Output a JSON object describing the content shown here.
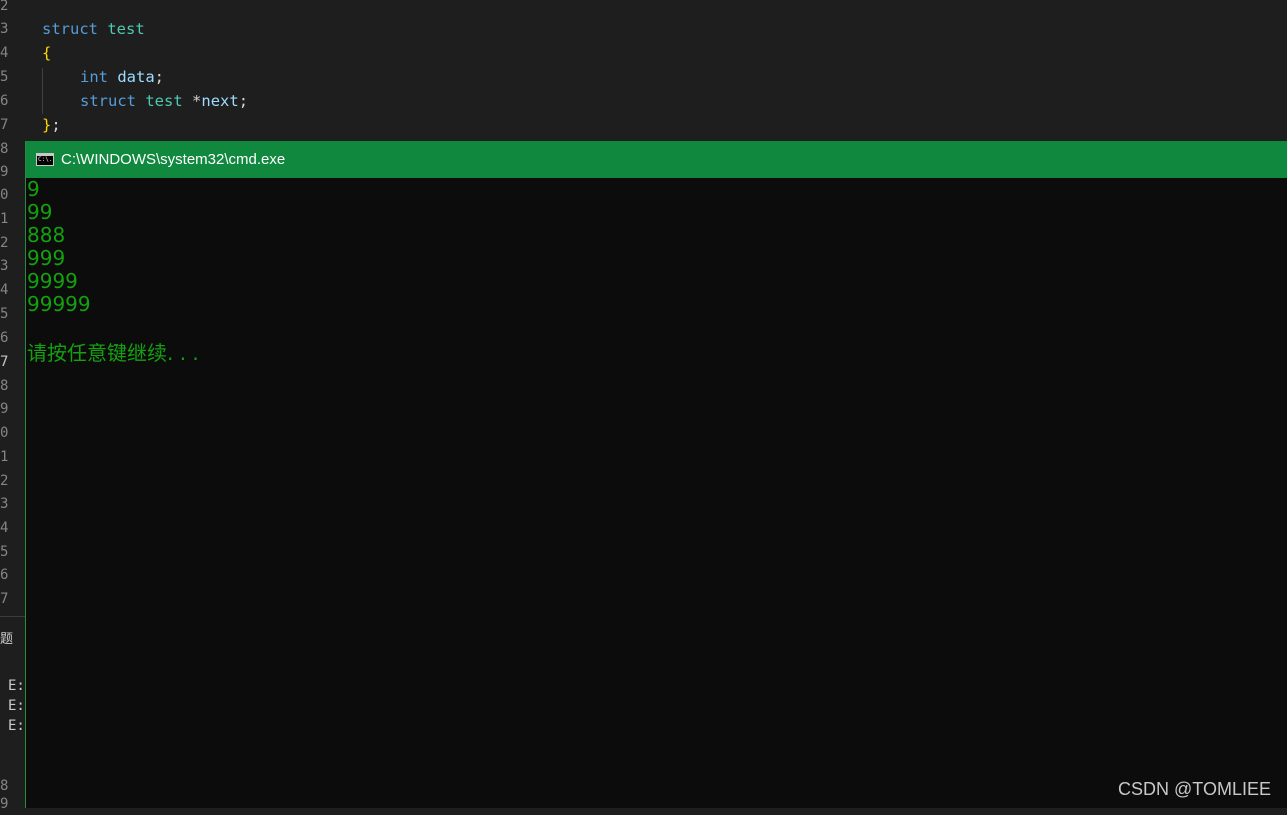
{
  "editor": {
    "gutter": [
      "2",
      "3",
      "4",
      "5",
      "6",
      "7",
      "8",
      "9",
      "0",
      "1",
      "2",
      "3",
      "4",
      "5",
      "6",
      "7",
      "8",
      "9",
      "0",
      "1",
      "2",
      "3",
      "4",
      "5",
      "6",
      "7"
    ],
    "gutter_bottom": [
      "8",
      "9"
    ],
    "code": {
      "line1_kw": "struct",
      "line1_ty": "test",
      "line2_brace": "{",
      "line3_kw": "int",
      "line3_var": "data",
      "line3_punc": ";",
      "line4_kw": "struct",
      "line4_ty": "test",
      "line4_star": "*",
      "line4_var": "next",
      "line4_punc": ";",
      "line5_brace": "}",
      "line5_punc": ";"
    },
    "panel_tab": "题",
    "terminal_lines": [
      "E:",
      "E:",
      "E:"
    ]
  },
  "cmd": {
    "title": "C:\\WINDOWS\\system32\\cmd.exe",
    "icon_text": "C:\\.",
    "output": [
      "9",
      "99",
      "888",
      "999",
      "9999",
      "99999"
    ],
    "prompt": "请按任意键继续. . ."
  },
  "watermark": "CSDN @TOMLIEE",
  "colors": {
    "titlebar": "#10893e",
    "console_text": "#13a10e",
    "console_bg": "#0c0c0c",
    "editor_bg": "#1e1e1e"
  }
}
